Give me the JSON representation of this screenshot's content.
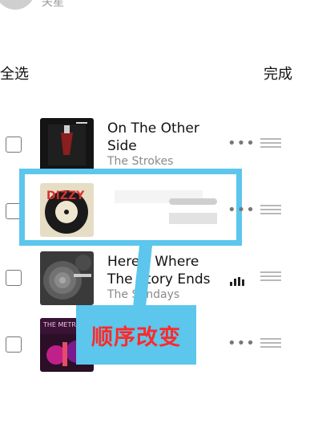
{
  "header": {
    "partial_top_text": "关星",
    "select_all": "全选",
    "done": "完成"
  },
  "songs": [
    {
      "title": "On The Other Side",
      "artist": "The Strokes",
      "more": "•••",
      "cover_text": ""
    },
    {
      "title": "",
      "artist": "",
      "more": "•••",
      "cover_text": "DIZZY"
    },
    {
      "title": "Here's Where The Story Ends",
      "artist": "The Sundays",
      "more": "",
      "cover_text": ""
    },
    {
      "title": "",
      "artist": "",
      "more": "•••",
      "cover_text": "THE METRO"
    }
  ],
  "annotation": {
    "label": "顺序改变"
  },
  "colors": {
    "annotation_blue": "#5cc6ec",
    "annotation_text": "#ff2a2a"
  }
}
